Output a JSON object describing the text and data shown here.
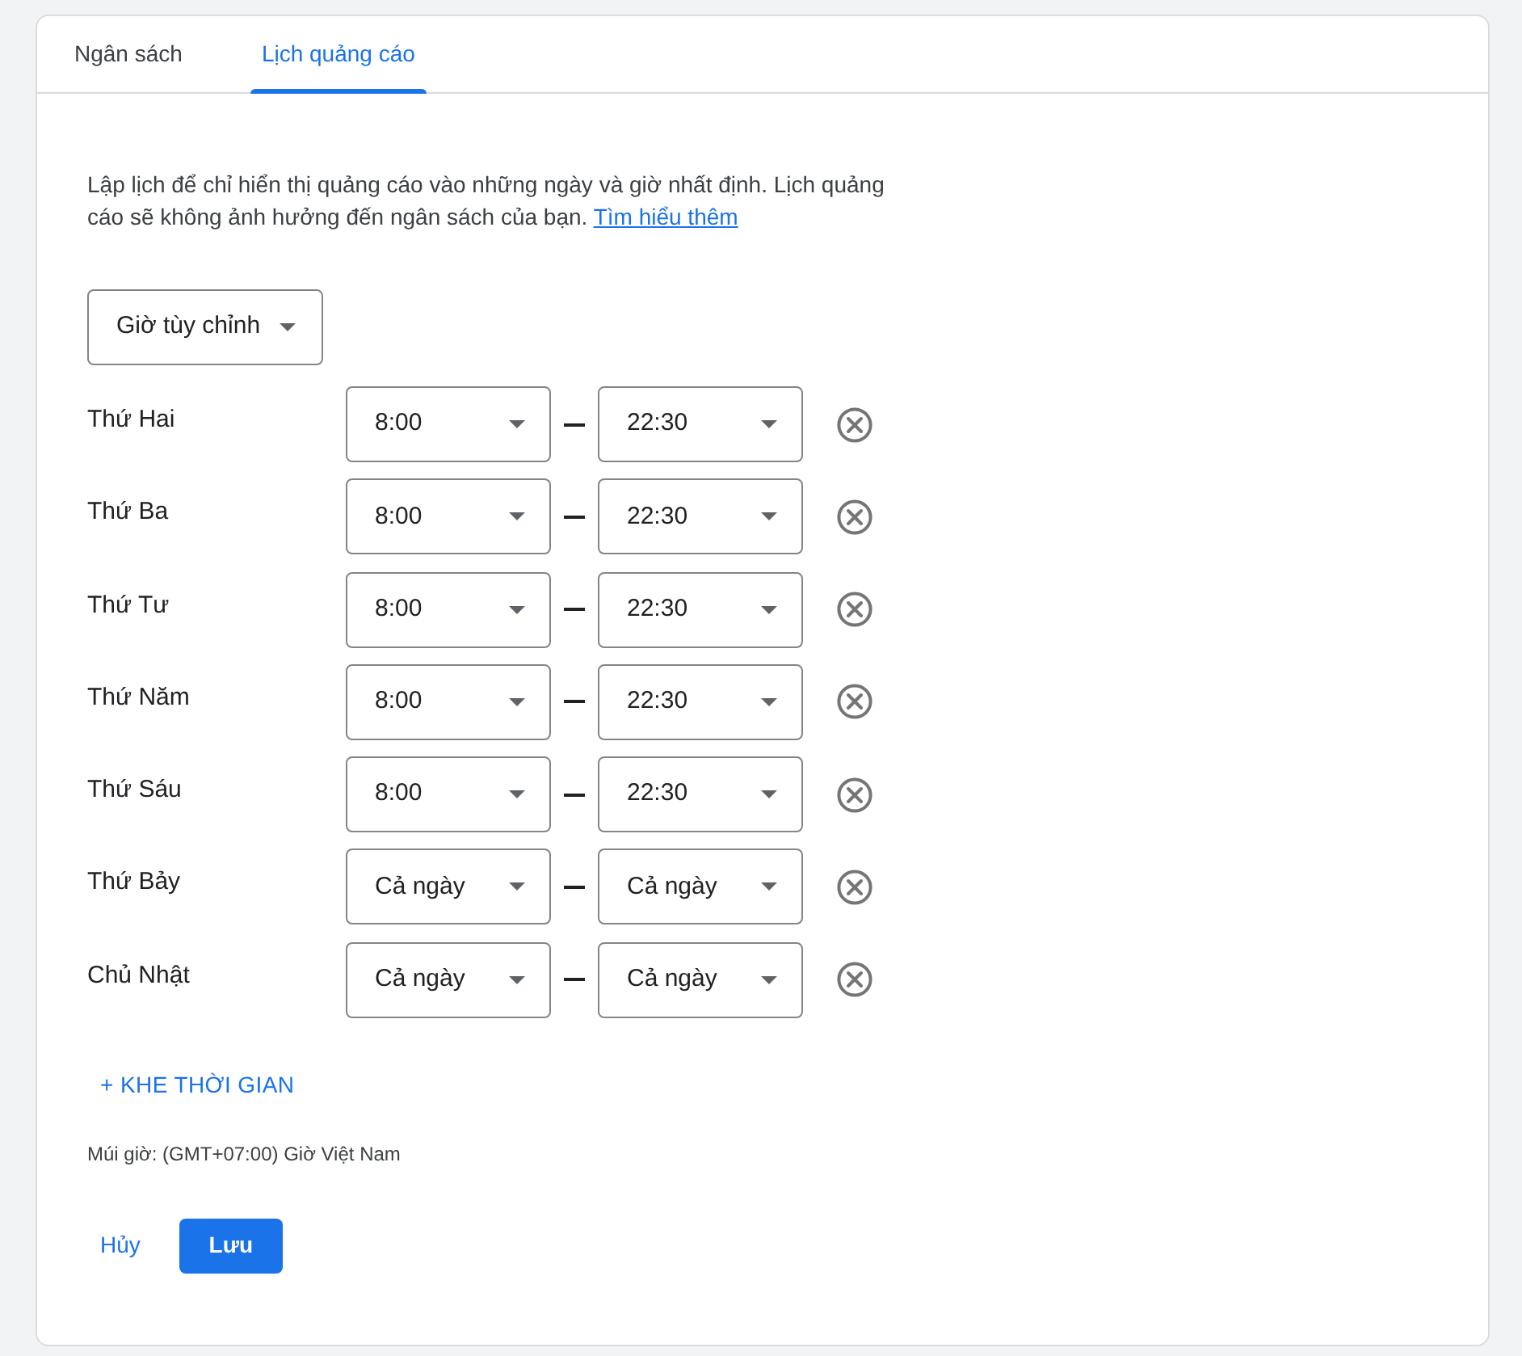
{
  "tabs": [
    {
      "label": "Ngân sách",
      "selected": false
    },
    {
      "label": "Lịch quảng cáo",
      "selected": true
    }
  ],
  "description": {
    "text": "Lập lịch để chỉ hiển thị quảng cáo vào những ngày và giờ nhất định. Lịch quảng cáo sẽ không ảnh hưởng đến ngân sách của bạn.",
    "link": "Tìm hiểu thêm"
  },
  "schedule_type": "Giờ tùy chỉnh",
  "days": [
    {
      "label": "Thứ Hai",
      "start": "8:00",
      "end": "22:30"
    },
    {
      "label": "Thứ Ba",
      "start": "8:00",
      "end": "22:30"
    },
    {
      "label": "Thứ Tư",
      "start": "8:00",
      "end": "22:30"
    },
    {
      "label": "Thứ Năm",
      "start": "8:00",
      "end": "22:30"
    },
    {
      "label": "Thứ Sáu",
      "start": "8:00",
      "end": "22:30"
    },
    {
      "label": "Thứ Bảy",
      "start": "Cả ngày",
      "end": "Cả ngày"
    },
    {
      "label": "Chủ Nhật",
      "start": "Cả ngày",
      "end": "Cả ngày"
    }
  ],
  "add_slot_button": "+ KHE THỜI GIAN",
  "timezone": "Múi giờ: (GMT+07:00) Giờ Việt Nam",
  "actions": [
    {
      "label": "Hủy",
      "kind": "text"
    },
    {
      "label": "Lưu",
      "kind": "filled"
    }
  ]
}
